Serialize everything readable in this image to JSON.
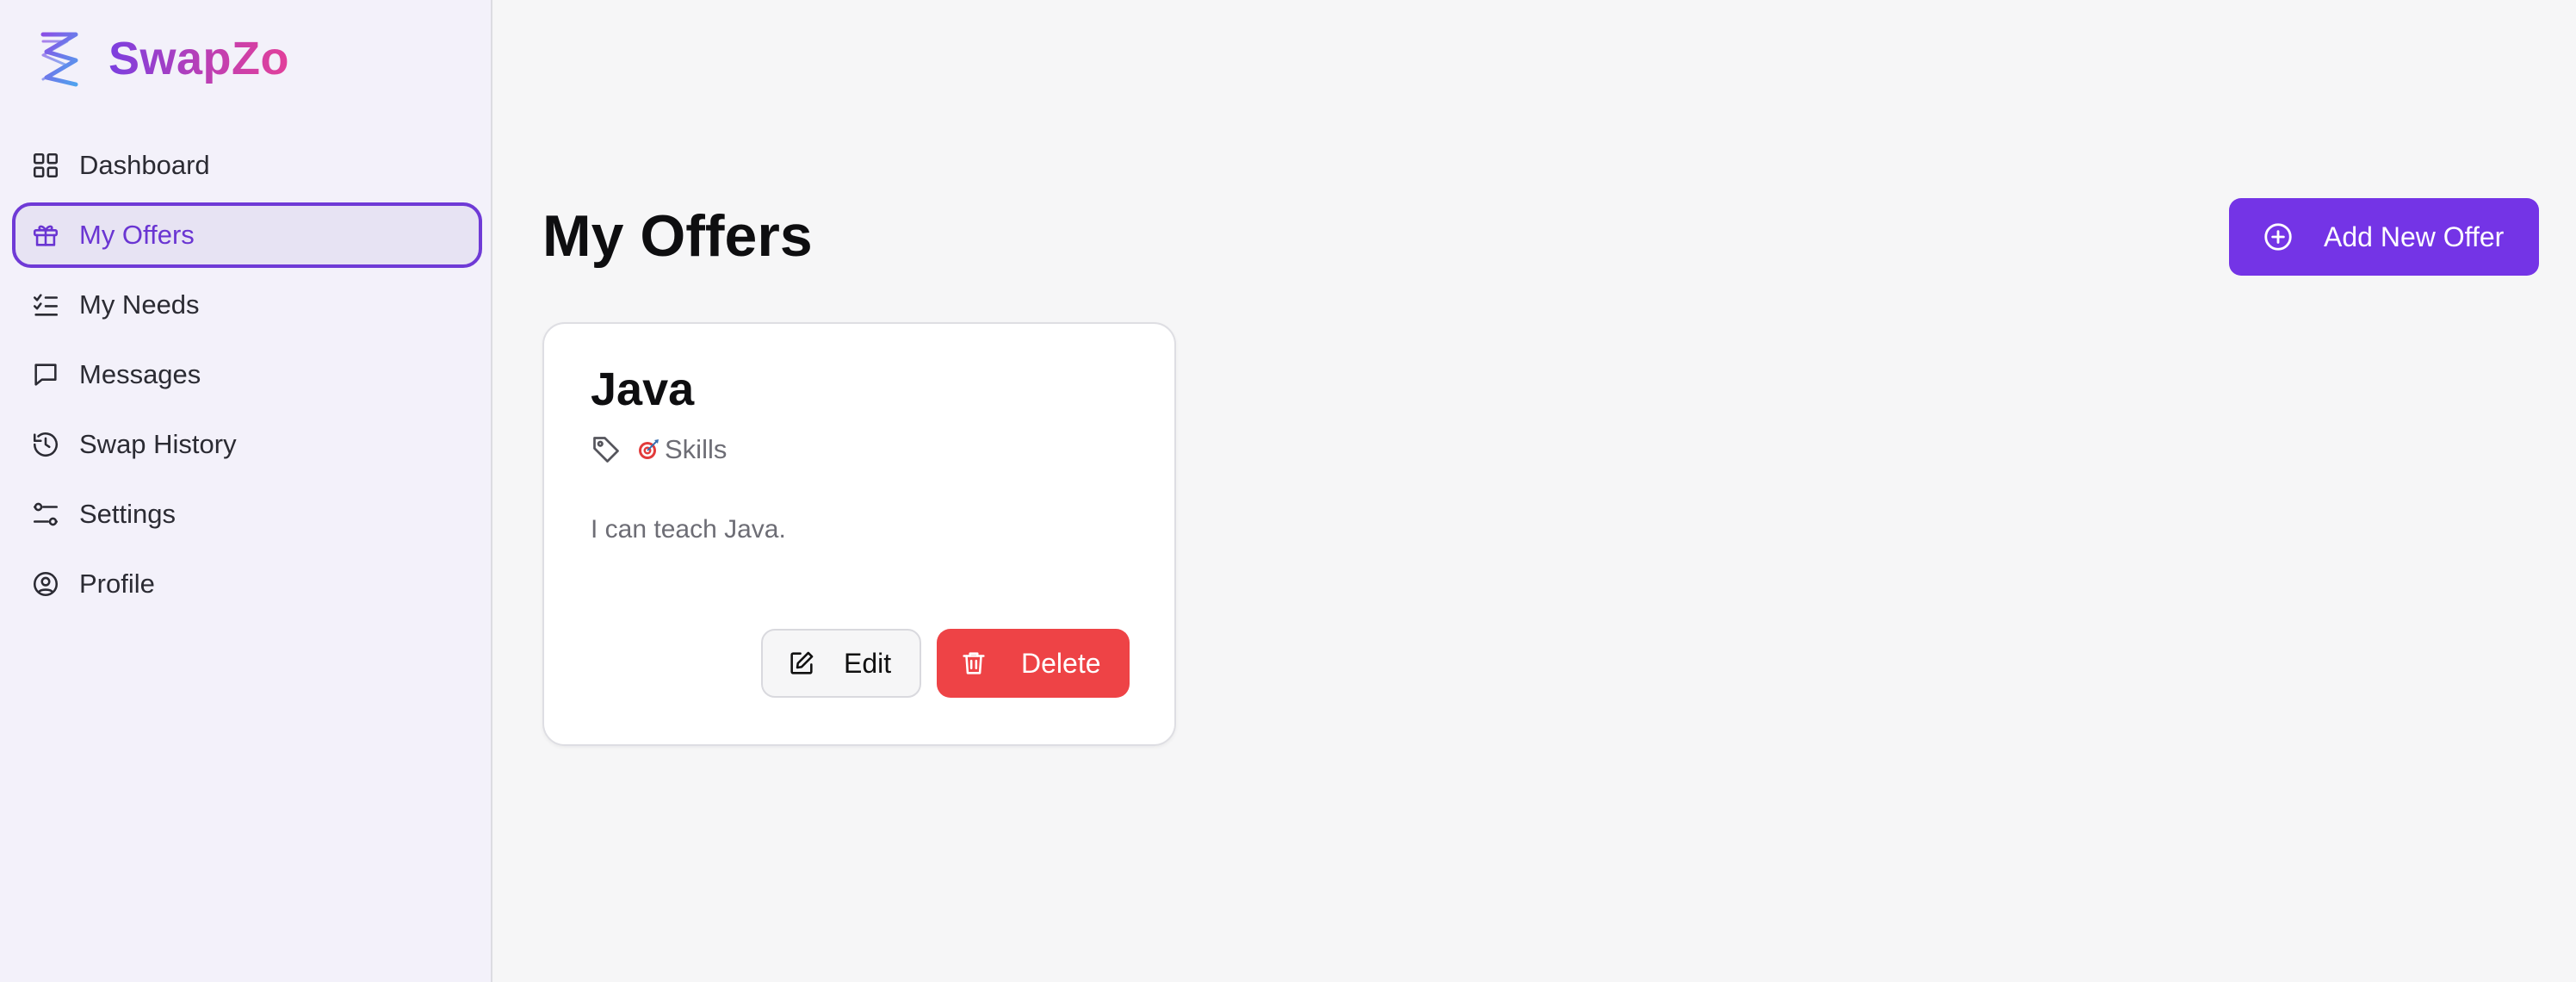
{
  "brand": {
    "name": "SwapZo",
    "logo_icon": "zigzag-logo-icon",
    "gradient": [
      "#7b3fe0",
      "#e2409a"
    ]
  },
  "sidebar": {
    "items": [
      {
        "label": "Dashboard",
        "icon": "grid-icon",
        "active": false
      },
      {
        "label": "My Offers",
        "icon": "gift-icon",
        "active": true
      },
      {
        "label": "My Needs",
        "icon": "checklist-icon",
        "active": false
      },
      {
        "label": "Messages",
        "icon": "message-icon",
        "active": false
      },
      {
        "label": "Swap History",
        "icon": "history-icon",
        "active": false
      },
      {
        "label": "Settings",
        "icon": "sliders-icon",
        "active": false
      },
      {
        "label": "Profile",
        "icon": "user-circle-icon",
        "active": false
      }
    ]
  },
  "main": {
    "title": "My Offers",
    "add_button_label": "Add New Offer",
    "offers": [
      {
        "title": "Java",
        "category_emoji": "🎯",
        "category": "Skills",
        "description": "I can teach Java.",
        "edit_label": "Edit",
        "delete_label": "Delete"
      }
    ]
  },
  "colors": {
    "accent": "#7434e6",
    "danger": "#ee4346",
    "sidebar_bg": "#f3f1fa",
    "active_border": "#6f3ad6"
  }
}
